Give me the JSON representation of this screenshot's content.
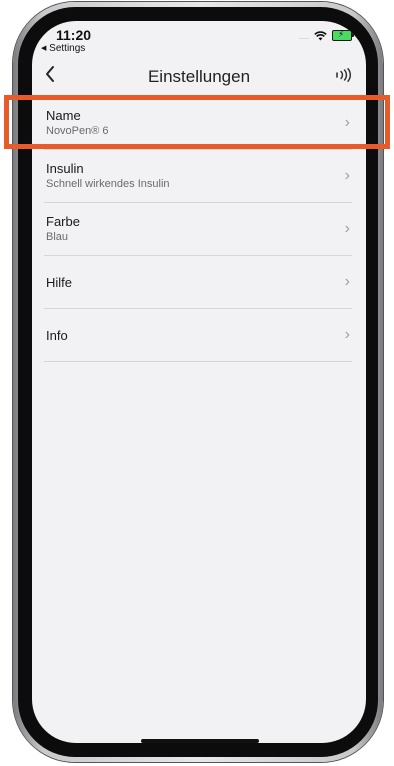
{
  "status_bar": {
    "time": "11:20",
    "back_app": "Settings",
    "signal": "....",
    "wifi_icon": "wifi-icon",
    "battery_icon": "battery-charging-icon"
  },
  "nav": {
    "title": "Einstellungen",
    "back_icon": "chevron-left-icon",
    "nfc_icon": "nfc-icon"
  },
  "list": {
    "items": [
      {
        "title": "Name",
        "subtitle": "NovoPen® 6"
      },
      {
        "title": "Insulin",
        "subtitle": "Schnell wirkendes Insulin"
      },
      {
        "title": "Farbe",
        "subtitle": "Blau"
      },
      {
        "title": "Hilfe"
      },
      {
        "title": "Info"
      }
    ]
  },
  "colors": {
    "highlight": "#e85a2a",
    "screen_bg": "#f2f2f4",
    "battery": "#4cd964"
  }
}
